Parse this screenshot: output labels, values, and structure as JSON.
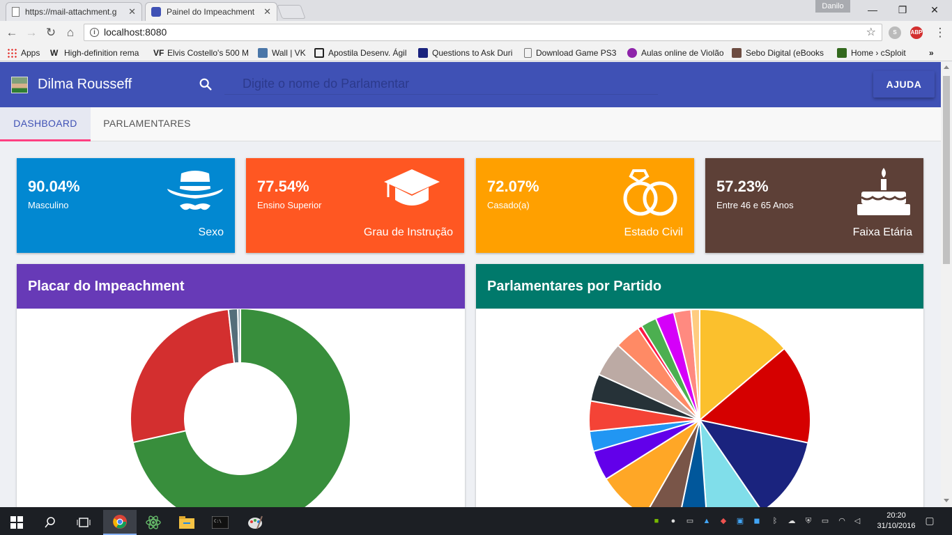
{
  "browser": {
    "tabs": [
      {
        "title": "https://mail-attachment.g",
        "close": "✕"
      },
      {
        "title": "Painel do Impeachment",
        "close": "✕"
      }
    ],
    "profile_name": "Danilo",
    "window_controls": {
      "minimize": "—",
      "maximize": "❐",
      "close": "✕"
    },
    "url": "localhost:8080",
    "bookmarks": [
      {
        "label": "Apps"
      },
      {
        "label": "High-definition rema"
      },
      {
        "label": "Elvis Costello's 500 M"
      },
      {
        "label": "Wall | VK"
      },
      {
        "label": "Apostila Desenv. Ágil"
      },
      {
        "label": "Questions to Ask Duri"
      },
      {
        "label": "Download Game PS3"
      },
      {
        "label": "Aulas online de Violão"
      },
      {
        "label": "Sebo Digital (eBooks"
      },
      {
        "label": "Home › cSploit"
      }
    ],
    "bookmarks_more": "»",
    "extensions": {
      "abp": "ABP"
    }
  },
  "app": {
    "title": "Dilma Rousseff",
    "search_placeholder": "Digite o nome do Parlamentar",
    "help_label": "AJUDA",
    "tabs": [
      {
        "label": "DASHBOARD",
        "active": true
      },
      {
        "label": "PARLAMENTARES",
        "active": false
      }
    ]
  },
  "stats": [
    {
      "percent": "90.04%",
      "label": "Masculino",
      "caption": "Sexo",
      "color": "#0288d1",
      "icon": "hat-mustache-icon"
    },
    {
      "percent": "77.54%",
      "label": "Ensino Superior",
      "caption": "Grau de Instrução",
      "color": "#ff5722",
      "icon": "graduation-cap-icon"
    },
    {
      "percent": "72.07%",
      "label": "Casado(a)",
      "caption": "Estado Civil",
      "color": "#ffa000",
      "icon": "rings-icon"
    },
    {
      "percent": "57.23%",
      "label": "Entre 46 e 65 Anos",
      "caption": "Faixa Etária",
      "color": "#5d4037",
      "icon": "birthday-cake-icon"
    }
  ],
  "cards": {
    "impeachment": {
      "title": "Placar do Impeachment",
      "color": "#673ab7"
    },
    "parties": {
      "title": "Parlamentares por Partido",
      "color": "#00796b"
    }
  },
  "chart_data": [
    {
      "type": "pie",
      "title": "Placar do Impeachment",
      "donut": true,
      "values": [
        367,
        137,
        7,
        2
      ],
      "colors": [
        "#388e3c",
        "#d32f2f",
        "#546e7a",
        "#90a4ae"
      ]
    },
    {
      "type": "pie",
      "title": "Parlamentares por Partido",
      "values": [
        66,
        69,
        58,
        40,
        21,
        24,
        37,
        21,
        14,
        21,
        19,
        24,
        18,
        3,
        11,
        13,
        12,
        6
      ],
      "colors": [
        "#fbc02d",
        "#d50000",
        "#1a237e",
        "#80deea",
        "#01579b",
        "#795548",
        "#ffa726",
        "#6200ea",
        "#2196f3",
        "#f44336",
        "#263238",
        "#bcaaa4",
        "#ff8a65",
        "#ff1744",
        "#4caf50",
        "#d500f9",
        "#ff8a80",
        "#ffcc80"
      ]
    }
  ],
  "taskbar": {
    "time": "20:20",
    "date": "31/10/2016"
  }
}
